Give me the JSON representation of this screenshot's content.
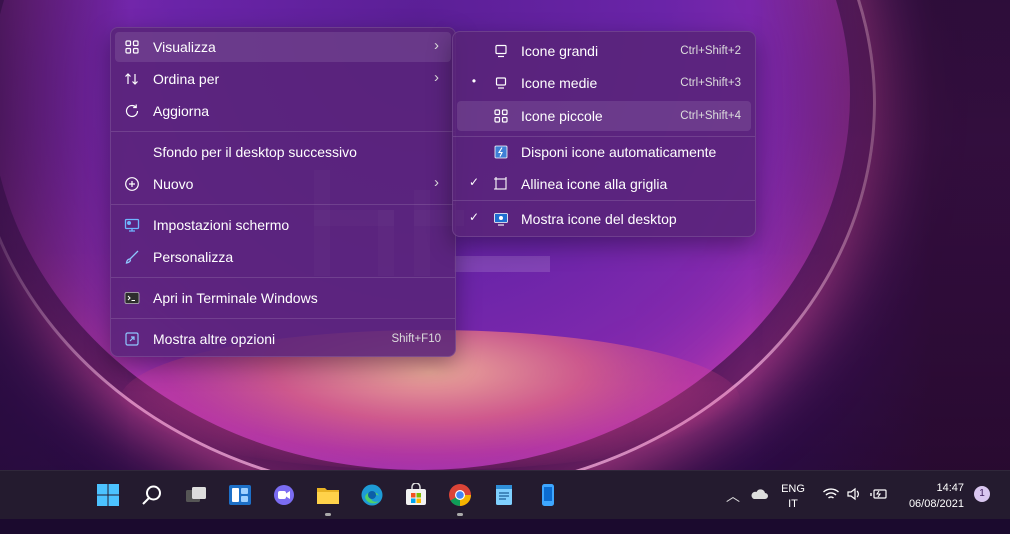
{
  "main_menu": {
    "items": [
      {
        "label": "Visualizza",
        "icon": "grid-icon",
        "has_submenu": true
      },
      {
        "label": "Ordina per",
        "icon": "sort-icon",
        "has_submenu": true
      },
      {
        "label": "Aggiorna",
        "icon": "refresh-icon"
      },
      {
        "label": "Sfondo per il desktop successivo"
      },
      {
        "label": "Nuovo",
        "icon": "plus-circle-icon",
        "has_submenu": true
      },
      {
        "label": "Impostazioni schermo",
        "icon": "display-settings-icon"
      },
      {
        "label": "Personalizza",
        "icon": "brush-icon"
      },
      {
        "label": "Apri in Terminale Windows",
        "icon": "terminal-icon"
      },
      {
        "label": "Mostra altre opzioni",
        "icon": "expand-icon",
        "shortcut": "Shift+F10"
      }
    ]
  },
  "sub_menu": {
    "items": [
      {
        "label": "Icone grandi",
        "icon": "monitor-icon",
        "shortcut": "Ctrl+Shift+2"
      },
      {
        "label": "Icone medie",
        "icon": "monitor-icon",
        "shortcut": "Ctrl+Shift+3",
        "mark": "•"
      },
      {
        "label": "Icone piccole",
        "icon": "grid-icon",
        "shortcut": "Ctrl+Shift+4"
      },
      {
        "label": "Disponi icone automaticamente",
        "icon": "auto-arrange-icon"
      },
      {
        "label": "Allinea icone alla griglia",
        "icon": "align-grid-icon",
        "mark": "✓"
      },
      {
        "label": "Mostra icone del desktop",
        "icon": "desktop-icon",
        "mark": "✓"
      }
    ]
  },
  "taskbar": {
    "apps": [
      "start-icon",
      "search-icon",
      "task-view-icon",
      "widgets-icon",
      "chat-icon",
      "file-explorer-icon",
      "edge-icon",
      "store-icon",
      "chrome-icon",
      "notepad-icon",
      "phone-icon"
    ],
    "language": "ENG",
    "region": "IT",
    "time": "14:47",
    "date": "06/08/2021",
    "notification_count": "1"
  },
  "colors": {
    "accent": "#5b2a86",
    "taskbar": "#241b2f"
  }
}
